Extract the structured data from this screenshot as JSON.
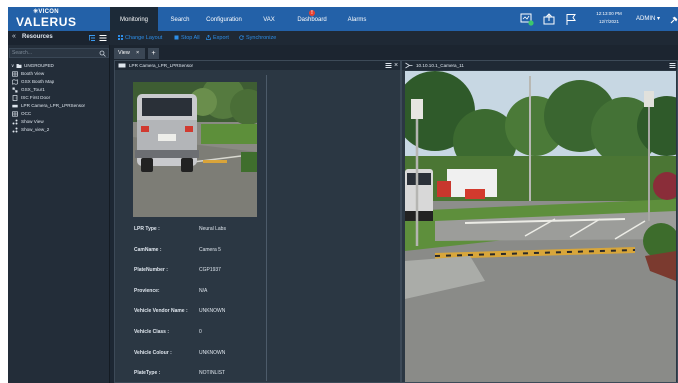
{
  "brand": {
    "top": "✳VICON",
    "main": "VALERUS"
  },
  "nav": {
    "tabs": [
      {
        "label": "Monitoring",
        "active": true
      },
      {
        "label": "Search"
      },
      {
        "label": "Configuration"
      },
      {
        "label": "VAX"
      },
      {
        "label": "Dashboard",
        "alert": "!"
      },
      {
        "label": "Alarms"
      }
    ],
    "icons": [
      "monitor-status-icon",
      "upload-icon",
      "flag-icon"
    ],
    "clock": {
      "time": "12:13:00 PM",
      "date": "12/7/2021"
    },
    "user": "ADMIN ▾"
  },
  "resources": {
    "title": "Resources",
    "collapse_glyph": "«",
    "search_placeholder": "Search...",
    "items": [
      {
        "label": "UNGROUPED",
        "icon": "folder-icon",
        "indent": 0,
        "expander": "∨"
      },
      {
        "label": "Booth View",
        "icon": "view-icon",
        "indent": 1
      },
      {
        "label": "GSX Booth Map",
        "icon": "map-icon",
        "indent": 1
      },
      {
        "label": "GSX_Tour1",
        "icon": "tour-icon",
        "indent": 1
      },
      {
        "label": "ISC First Door",
        "icon": "door-icon",
        "indent": 1
      },
      {
        "label": "LPR Camera_LPR_LPRSensor",
        "icon": "camera-icon",
        "indent": 1
      },
      {
        "label": "OCC",
        "icon": "view-icon",
        "indent": 1
      },
      {
        "label": "Show View",
        "icon": "show-icon",
        "indent": 1
      },
      {
        "label": "Show_view_2",
        "icon": "show-icon",
        "indent": 1
      }
    ]
  },
  "toolbar": {
    "items": [
      {
        "label": "Change Layout",
        "icon": "layout-icon"
      },
      {
        "label": "Stop All",
        "icon": "stop-icon"
      },
      {
        "label": "Export",
        "icon": "export-icon"
      },
      {
        "label": "Synchronize",
        "icon": "sync-icon"
      }
    ]
  },
  "tabs": {
    "view_label": "View",
    "close_glyph": "×",
    "add_glyph": "+"
  },
  "panes": {
    "left": {
      "title": "LPR Camera_LPR_LPRSensor",
      "close_glyph": "×",
      "fields": [
        {
          "key": "LPR Type :",
          "value": "Neural Labs"
        },
        {
          "key": "CamName :",
          "value": "Camera 5"
        },
        {
          "key": "PlateNumber :",
          "value": "CGP1937"
        },
        {
          "key": "Provience:",
          "value": "N/A"
        },
        {
          "key": "Vehicle Vendor Name :",
          "value": "UNKNOWN"
        },
        {
          "key": "Vehicle Class :",
          "value": "0"
        },
        {
          "key": "Vehicle Colour :",
          "value": "UNKNOWN"
        },
        {
          "key": "PlateType :",
          "value": "NOTINLIST"
        }
      ]
    },
    "right": {
      "title": "10.10.10.1_Camera_11"
    }
  },
  "colors": {
    "nav_bg": "#2361a8",
    "app_bg": "#1d2733",
    "accent": "#2d8ee8",
    "alert": "#e8402f"
  }
}
